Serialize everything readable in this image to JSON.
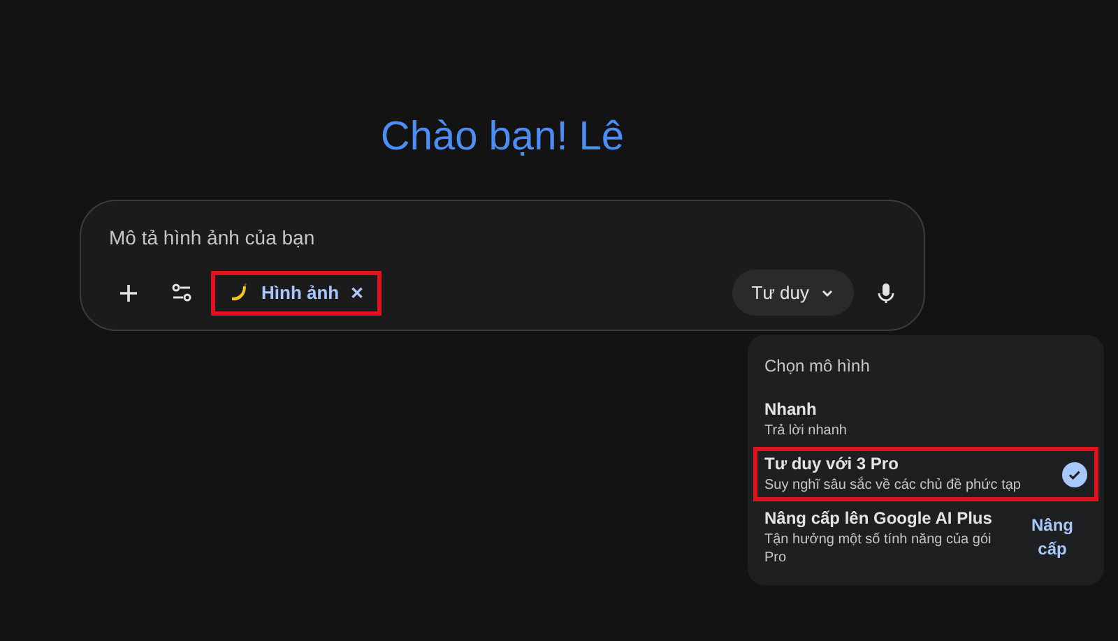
{
  "greeting": "Chào bạn! Lê",
  "prompt": {
    "placeholder": "Mô tả hình ảnh của bạn"
  },
  "tool_chip": {
    "label": "Hình ảnh",
    "remove": "✕",
    "highlighted": true
  },
  "mode_button": {
    "label": "Tư duy"
  },
  "model_menu": {
    "title": "Chọn mô hình",
    "items": [
      {
        "kind": "option",
        "name": "Nhanh",
        "description": "Trả lời nhanh",
        "selected": false,
        "highlighted": false
      },
      {
        "kind": "option",
        "name": "Tư duy với 3 Pro",
        "description": "Suy nghĩ sâu sắc về các chủ đề phức tạp",
        "selected": true,
        "highlighted": true
      },
      {
        "kind": "upgrade",
        "name": "Nâng cấp lên Google AI Plus",
        "description": "Tận hưởng một số tính năng của gói Pro",
        "action": "Nâng cấp",
        "selected": false,
        "highlighted": false
      }
    ]
  }
}
